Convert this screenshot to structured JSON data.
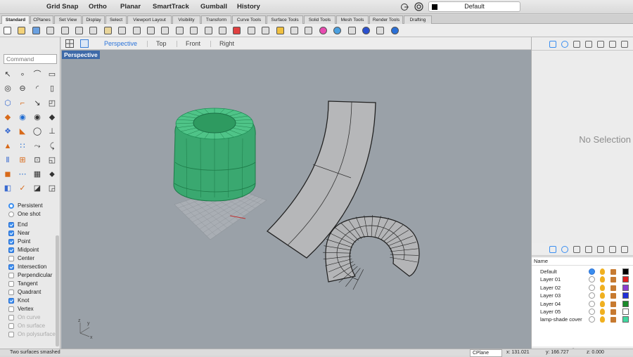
{
  "modes": {
    "grid_snap": "Grid Snap",
    "ortho": "Ortho",
    "planar": "Planar",
    "smarttrack": "SmartTrack",
    "gumball": "Gumball",
    "history": "History"
  },
  "layer_selector": {
    "value": "Default",
    "color": "#000000"
  },
  "tabs": [
    "Standard",
    "CPlanes",
    "Set View",
    "Display",
    "Select",
    "Viewport Layout",
    "Visibility",
    "Transform",
    "Curve Tools",
    "Surface Tools",
    "Solid Tools",
    "Mesh Tools",
    "Render Tools",
    "Drafting"
  ],
  "command": {
    "placeholder": "Command"
  },
  "osnap": {
    "persistent": "Persistent",
    "one_shot": "One shot",
    "items": [
      {
        "label": "End",
        "checked": true
      },
      {
        "label": "Near",
        "checked": true
      },
      {
        "label": "Point",
        "checked": true
      },
      {
        "label": "Midpoint",
        "checked": true
      },
      {
        "label": "Center",
        "checked": false
      },
      {
        "label": "Intersection",
        "checked": true
      },
      {
        "label": "Perpendicular",
        "checked": false
      },
      {
        "label": "Tangent",
        "checked": false
      },
      {
        "label": "Quadrant",
        "checked": false
      },
      {
        "label": "Knot",
        "checked": true
      },
      {
        "label": "Vertex",
        "checked": false
      },
      {
        "label": "On curve",
        "checked": false
      },
      {
        "label": "On surface",
        "checked": false
      },
      {
        "label": "On polysurface",
        "checked": false
      }
    ]
  },
  "viewport_tabs": {
    "perspective": "Perspective",
    "top": "Top",
    "front": "Front",
    "right": "Right"
  },
  "viewport": {
    "label": "Perspective",
    "axis_x": "x",
    "axis_y": "y",
    "axis_z": "z"
  },
  "properties": {
    "no_selection": "No Selection"
  },
  "layers": {
    "header_name": "Name",
    "items": [
      {
        "name": "Default",
        "current": true,
        "color": "#000000"
      },
      {
        "name": "Layer 01",
        "current": false,
        "color": "#e02020"
      },
      {
        "name": "Layer 02",
        "current": false,
        "color": "#8a3dd0"
      },
      {
        "name": "Layer 03",
        "current": false,
        "color": "#2030d8"
      },
      {
        "name": "Layer 04",
        "current": false,
        "color": "#1a8a2a"
      },
      {
        "name": "Layer 05",
        "current": false,
        "color": "#ffffff"
      },
      {
        "name": "lamp-shade cover",
        "current": false,
        "color": "#40d8a0"
      }
    ]
  },
  "status": {
    "message": "Two surfaces smashed",
    "cplane": "CPlane",
    "x": "x: 131.021",
    "y": "y: 166.727",
    "z": "z: 0.000"
  }
}
